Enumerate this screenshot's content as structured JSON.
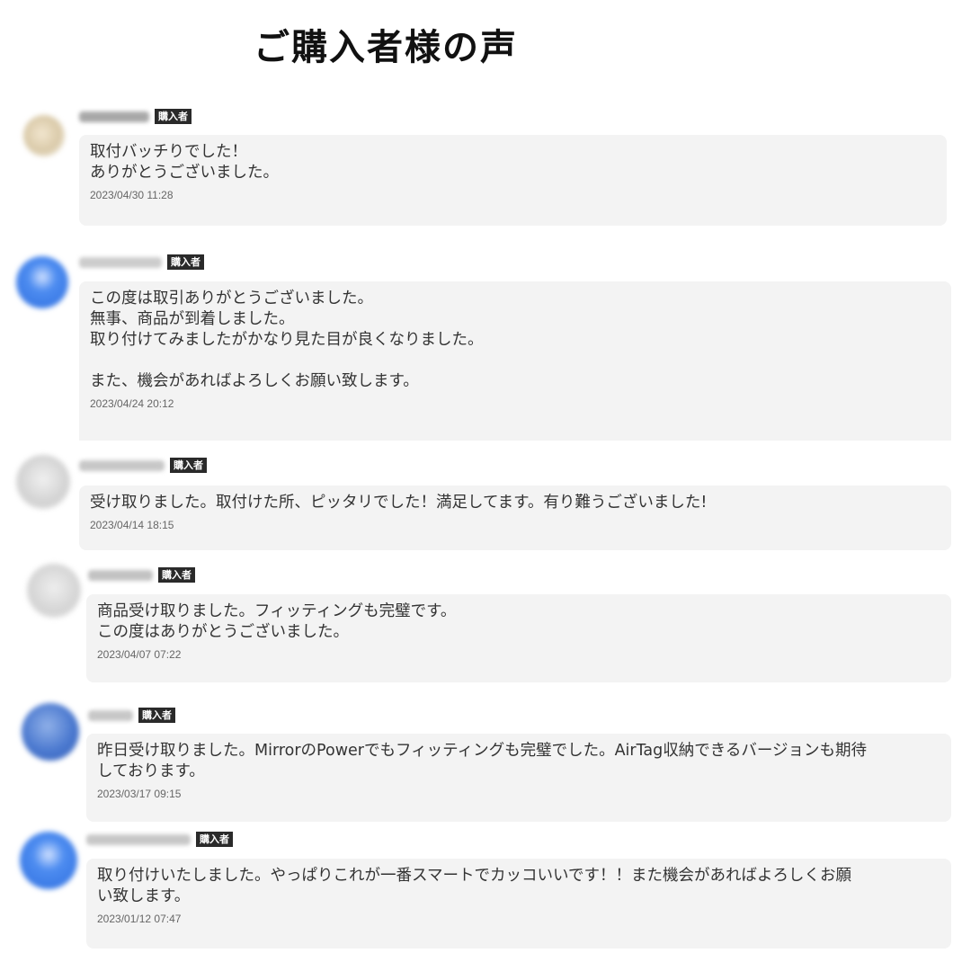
{
  "title": "ご購入者様の声",
  "badge_label": "購入者",
  "colors": {
    "bubble": "#f3f3f3",
    "badge": "#2a2a2a",
    "text": "#333333"
  },
  "reviews": [
    {
      "avatar": "blurred-cat-avatar",
      "message": "取付バッチりでした！\nありがとうございました。",
      "date": "2023/04/30 11:28"
    },
    {
      "avatar": "blurred-blue-user-avatar",
      "message": "この度は取引ありがとうございました。\n無事、商品が到着しました。\n取り付けてみましたがかなり見た目が良くなりました。\n\nまた、機会があればよろしくお願い致します。",
      "date": "2023/04/24 20:12"
    },
    {
      "avatar": "blurred-gray-avatar",
      "message": "受け取りました。取付けた所、ピッタリでした！満足してます。有り難うございました!",
      "date": "2023/04/14 18:15"
    },
    {
      "avatar": "blurred-gray-avatar",
      "message": "商品受け取りました。フィッティングも完璧です。\nこの度はありがとうございました。",
      "date": "2023/04/07 07:22"
    },
    {
      "avatar": "blurred-blue-avatar",
      "message": "昨日受け取りました。MirrorのPowerでもフィッティングも完璧でした。AirTag収納できるバージョンも期待\nしております。",
      "date": "2023/03/17 09:15"
    },
    {
      "avatar": "blurred-blue-user-avatar",
      "message": "取り付けいたしました。やっぱりこれが一番スマートでカッコいいです！！また機会があればよろしくお願\nい致します。",
      "date": "2023/01/12 07:47"
    }
  ]
}
